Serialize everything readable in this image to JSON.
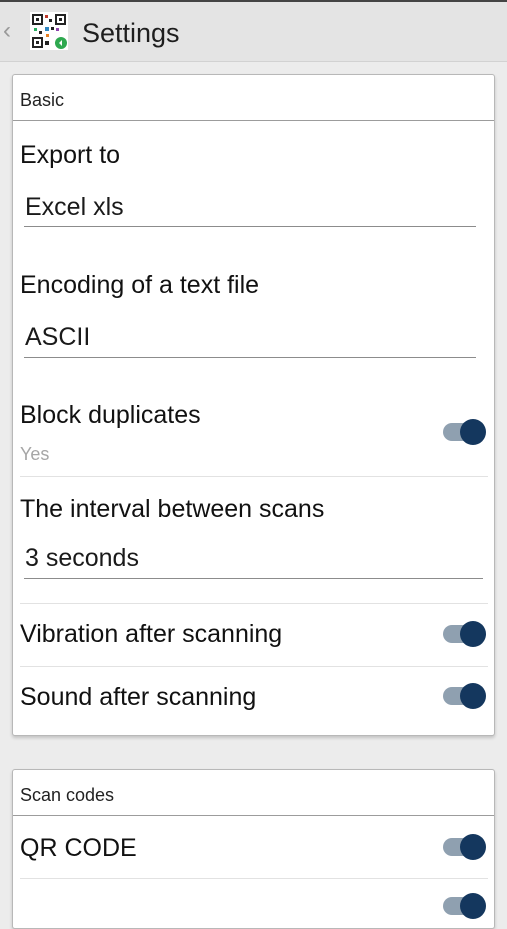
{
  "appbar": {
    "title": "Settings",
    "back_glyph": "‹",
    "icon": "qr-app-icon"
  },
  "sections": {
    "basic": {
      "header": "Basic",
      "export_to": {
        "title": "Export to",
        "value": "Excel xls"
      },
      "encoding": {
        "title": "Encoding of a text file",
        "value": "ASCII"
      },
      "block_duplicates": {
        "title": "Block duplicates",
        "summary": "Yes",
        "enabled": true
      },
      "interval": {
        "title": "The interval between scans",
        "value": "3 seconds"
      },
      "vibration": {
        "title": "Vibration after scanning",
        "enabled": true
      },
      "sound": {
        "title": "Sound after scanning",
        "enabled": true
      }
    },
    "scan_codes": {
      "header": "Scan codes",
      "qr_code": {
        "title": "QR CODE",
        "enabled": true
      },
      "next_item": {
        "title": "",
        "enabled": true
      }
    }
  },
  "colors": {
    "toggle_track": "#8fa0b0",
    "toggle_thumb": "#14375e",
    "appbar_bg": "#e4e4e4",
    "page_bg": "#ececec"
  }
}
